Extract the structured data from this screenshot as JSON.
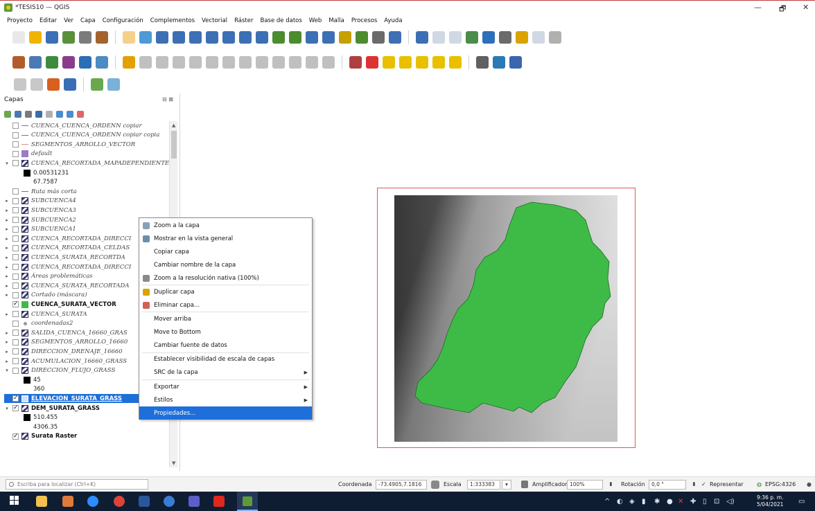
{
  "window": {
    "title": "*TESIS10 — QGIS",
    "controls": {
      "minimize": "—",
      "maximize": "🗗",
      "close": "✕"
    }
  },
  "menu": [
    "Proyecto",
    "Editar",
    "Ver",
    "Capa",
    "Configuración",
    "Complementos",
    "Vectorial",
    "Ráster",
    "Base de datos",
    "Web",
    "Malla",
    "Procesos",
    "Ayuda"
  ],
  "layers_panel": {
    "title": "Capas",
    "controls": "⊟ ⊠",
    "rows": [
      {
        "label": "CUENCA_CUENCA_ORDENN copiar",
        "icon": "line-gray-icon",
        "style": "italic",
        "checked": false,
        "expander": ""
      },
      {
        "label": "CUENCA_CUENCA_ORDENN copiar copia",
        "icon": "line-gray-icon",
        "style": "italic",
        "checked": false,
        "expander": ""
      },
      {
        "label": "SEGMENTOS_ARROLLO_VECTOR",
        "icon": "line-pink-icon",
        "style": "italic",
        "checked": false,
        "expander": ""
      },
      {
        "label": "default",
        "icon": "fill-icon",
        "style": "italic",
        "checked": false,
        "expander": ""
      },
      {
        "label": "CUENCA_RECORTADA_MAPADEPENDIENTE",
        "icon": "raster-icon",
        "style": "italic",
        "checked": false,
        "expander": "▾"
      },
      {
        "label": "0.00531231",
        "icon": "swatch-icon",
        "style": "legend",
        "checked": null,
        "expander": ""
      },
      {
        "label": "67.7587",
        "icon": "",
        "style": "legend-text",
        "checked": null,
        "expander": ""
      },
      {
        "label": "Ruta más corta",
        "icon": "line-gray-icon",
        "style": "italic",
        "checked": false,
        "expander": ""
      },
      {
        "label": "SUBCUENCA4",
        "icon": "raster-icon",
        "style": "italic",
        "checked": false,
        "expander": "▸"
      },
      {
        "label": "SUBCUENCA3",
        "icon": "raster-icon",
        "style": "italic",
        "checked": false,
        "expander": "▸"
      },
      {
        "label": "SUBCUENCA2",
        "icon": "raster-icon",
        "style": "italic",
        "checked": false,
        "expander": "▸"
      },
      {
        "label": "SUBCUENCA1",
        "icon": "raster-icon",
        "style": "italic",
        "checked": false,
        "expander": "▸"
      },
      {
        "label": "CUENCA_RECORTADA_DIRECCI",
        "icon": "raster-icon",
        "style": "italic",
        "checked": false,
        "expander": "▸"
      },
      {
        "label": "CUENCA_RECORTADA_CELDAS",
        "icon": "raster-icon",
        "style": "italic",
        "checked": false,
        "expander": "▸"
      },
      {
        "label": "CUENCA_SURATA_RECORTDA",
        "icon": "raster-icon",
        "style": "italic",
        "checked": false,
        "expander": "▸"
      },
      {
        "label": "CUENCA_RECORTADA_DIRECCI",
        "icon": "raster-icon",
        "style": "italic",
        "checked": false,
        "expander": "▸"
      },
      {
        "label": "Áreas problemáticas",
        "icon": "raster-icon",
        "style": "italic",
        "checked": false,
        "expander": "▸"
      },
      {
        "label": "CUENCA_SURATA_RECORTADA",
        "icon": "raster-icon",
        "style": "italic",
        "checked": false,
        "expander": "▸"
      },
      {
        "label": "Cortado (máscara)",
        "icon": "raster-icon",
        "style": "italic",
        "checked": false,
        "expander": "▸"
      },
      {
        "label": "CUENCA_SURATA_VECTOR",
        "icon": "fill-green-icon",
        "style": "bold",
        "checked": true,
        "expander": ""
      },
      {
        "label": "CUENCA_SURATA",
        "icon": "raster-icon",
        "style": "italic",
        "checked": false,
        "expander": "▸"
      },
      {
        "label": "coordenadas2",
        "icon": "point-icon",
        "style": "italic",
        "checked": false,
        "expander": ""
      },
      {
        "label": "SALIDA_CUENCA_16660_GRAS",
        "icon": "raster-icon",
        "style": "italic",
        "checked": false,
        "expander": "▸"
      },
      {
        "label": "SEGMENTOS_ARROLLO_16660",
        "icon": "raster-icon",
        "style": "italic",
        "checked": false,
        "expander": "▸"
      },
      {
        "label": "DIRECCION_DRENAJE_16660",
        "icon": "raster-icon",
        "style": "italic",
        "checked": false,
        "expander": "▸"
      },
      {
        "label": "ACUMULACION_16660_GRASS",
        "icon": "raster-icon",
        "style": "italic",
        "checked": false,
        "expander": "▸"
      },
      {
        "label": "DIRECCION_FLUJO_GRASS",
        "icon": "raster-icon",
        "style": "italic",
        "checked": false,
        "expander": "▾"
      },
      {
        "label": "45",
        "icon": "swatch-icon",
        "style": "legend",
        "checked": null,
        "expander": ""
      },
      {
        "label": "360",
        "icon": "",
        "style": "legend-text",
        "checked": null,
        "expander": ""
      },
      {
        "label": "ELEVACION_SURATA_GRASS",
        "icon": "raster-icon",
        "style": "selected",
        "checked": true,
        "expander": ""
      },
      {
        "label": "DEM_SURATA_GRASS",
        "icon": "raster-icon",
        "style": "bold",
        "checked": true,
        "expander": "▾"
      },
      {
        "label": "510.455",
        "icon": "swatch-icon",
        "style": "legend",
        "checked": null,
        "expander": ""
      },
      {
        "label": "4306.35",
        "icon": "",
        "style": "legend-text",
        "checked": null,
        "expander": ""
      },
      {
        "label": "Surata Raster",
        "icon": "raster-icon",
        "style": "bold",
        "checked": true,
        "expander": ""
      }
    ]
  },
  "context_menu": {
    "items": [
      {
        "label": "Zoom a la capa",
        "icon": "zoom-layer-icon",
        "submenu": false,
        "highlight": false,
        "sep_after": false
      },
      {
        "label": "Mostrar en la vista general",
        "icon": "overview-icon",
        "submenu": false,
        "highlight": false,
        "sep_after": false
      },
      {
        "label": "Copiar capa",
        "icon": "",
        "submenu": false,
        "highlight": false,
        "sep_after": false
      },
      {
        "label": "Cambiar nombre de la capa",
        "icon": "",
        "submenu": false,
        "highlight": false,
        "sep_after": false
      },
      {
        "label": "Zoom a la resolución nativa (100%)",
        "icon": "zoom-native-icon",
        "submenu": false,
        "highlight": false,
        "sep_after": true
      },
      {
        "label": "Duplicar capa",
        "icon": "duplicate-icon",
        "submenu": false,
        "highlight": false,
        "sep_after": false
      },
      {
        "label": "Eliminar capa...",
        "icon": "delete-layer-icon",
        "submenu": false,
        "highlight": false,
        "sep_after": true
      },
      {
        "label": "Mover arriba",
        "icon": "",
        "submenu": false,
        "highlight": false,
        "sep_after": false
      },
      {
        "label": "Move to Bottom",
        "icon": "",
        "submenu": false,
        "highlight": false,
        "sep_after": false
      },
      {
        "label": "Cambiar fuente de datos",
        "icon": "",
        "submenu": false,
        "highlight": false,
        "sep_after": true
      },
      {
        "label": "Establecer visibilidad de escala de capas",
        "icon": "",
        "submenu": false,
        "highlight": false,
        "sep_after": false
      },
      {
        "label": "SRC de la capa",
        "icon": "",
        "submenu": true,
        "highlight": false,
        "sep_after": true
      },
      {
        "label": "Exportar",
        "icon": "",
        "submenu": true,
        "highlight": false,
        "sep_after": false
      },
      {
        "label": "Estilos",
        "icon": "",
        "submenu": true,
        "highlight": false,
        "sep_after": false
      },
      {
        "label": "Propiedades...",
        "icon": "",
        "submenu": false,
        "highlight": true,
        "sep_after": false
      }
    ]
  },
  "statusbar": {
    "search_placeholder": "Escriba para localizar (Ctrl+K)",
    "coord_label": "Coordenada",
    "coord_value": "-73.4905,7.1816",
    "scale_label": "Escala",
    "scale_value": "1:333383",
    "magnifier_label": "Amplificador",
    "magnifier_value": "100%",
    "rotation_label": "Rotación",
    "rotation_value": "0,0 °",
    "render_label": "Representar",
    "crs": "EPSG:4326"
  },
  "taskbar": {
    "time": "9:36 p. m.",
    "date": "5/04/2021"
  },
  "colors": {
    "watershed": "#3dbb46",
    "selection": "#1e6fd9",
    "map_frame": "#e05555"
  }
}
